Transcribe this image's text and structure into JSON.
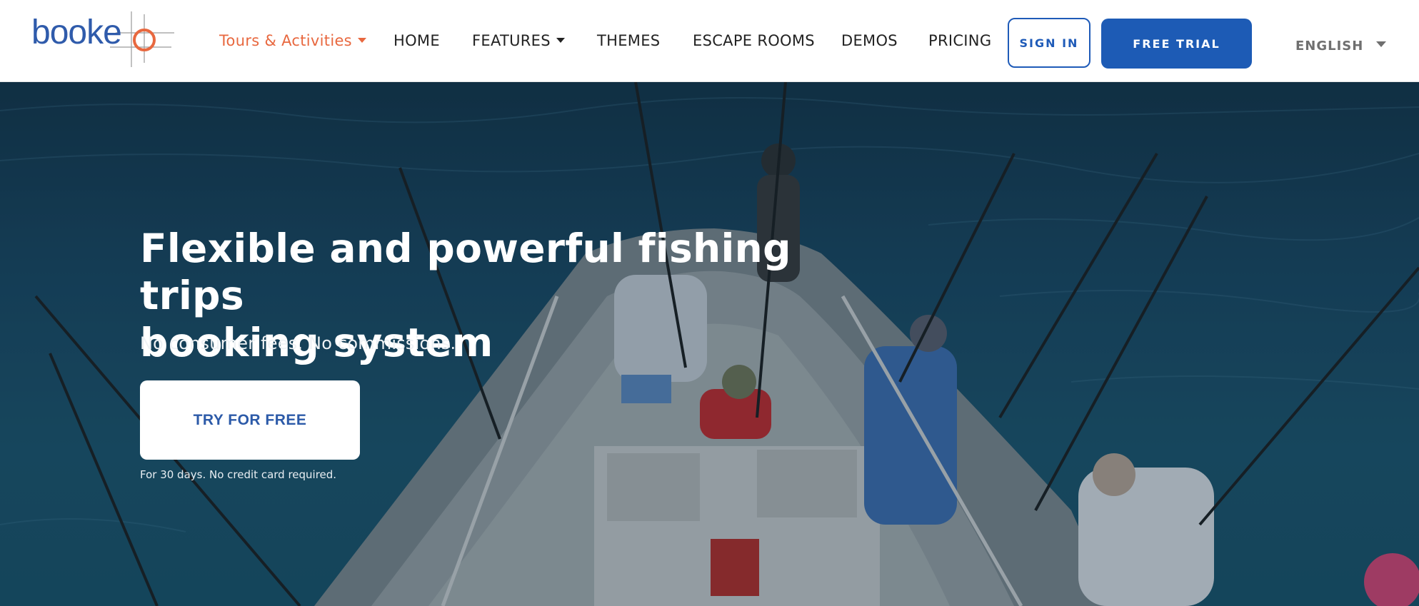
{
  "brand": {
    "logo_text": "booke"
  },
  "nav": {
    "items": [
      {
        "label": "Tours & Activities",
        "dropdown": true,
        "active": true
      },
      {
        "label": "HOME",
        "dropdown": false,
        "active": false
      },
      {
        "label": "FEATURES",
        "dropdown": true,
        "active": false
      },
      {
        "label": "THEMES",
        "dropdown": false,
        "active": false
      },
      {
        "label": "ESCAPE ROOMS",
        "dropdown": false,
        "active": false
      },
      {
        "label": "DEMOS",
        "dropdown": false,
        "active": false
      },
      {
        "label": "PRICING",
        "dropdown": false,
        "active": false
      }
    ],
    "sign_in_label": "SIGN IN",
    "free_trial_label": "FREE TRIAL",
    "language": "ENGLISH"
  },
  "hero": {
    "title_line1": "Flexible and powerful fishing trips",
    "title_line2": "booking system",
    "subtitle": "No consumer fees. No commissions.",
    "cta_label": "TRY FOR FREE",
    "note": "For 30 days. No credit card required."
  },
  "colors": {
    "accent_orange": "#e8683f",
    "brand_blue": "#1d5bb5",
    "logo_blue": "#2f5bab"
  }
}
